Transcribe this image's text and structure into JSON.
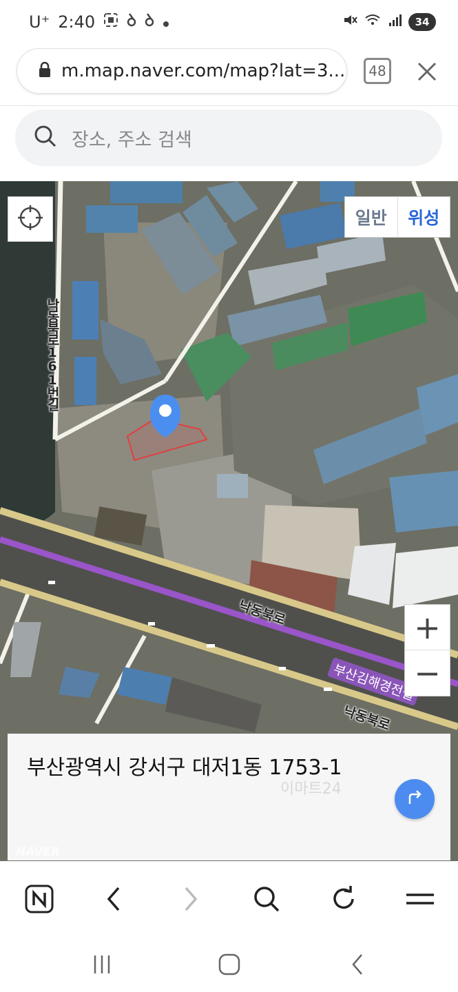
{
  "status": {
    "carrier": "U⁺",
    "time": "2:40",
    "battery": "34"
  },
  "browser": {
    "url": "m.map.naver.com/map?lat=3...",
    "tab_count": "48"
  },
  "search": {
    "placeholder": "장소, 주소 검색"
  },
  "map": {
    "type_normal": "일반",
    "type_satellite": "위성",
    "zoom_in": "+",
    "zoom_out": "−",
    "road_labels": {
      "vertical_road": "낙동북로161번길",
      "main_road_1": "낙동북로",
      "main_road_2": "낙동북로",
      "rail": "부산김해경전철"
    }
  },
  "address_card": {
    "address": "부산광역시 강서구 대저1동 1753-1",
    "ghost_label": "이마트24",
    "logo": "NAVER"
  },
  "colors": {
    "accent": "#2b67d9",
    "route_button": "#4c8cf0",
    "rail": "#8a55b8"
  }
}
